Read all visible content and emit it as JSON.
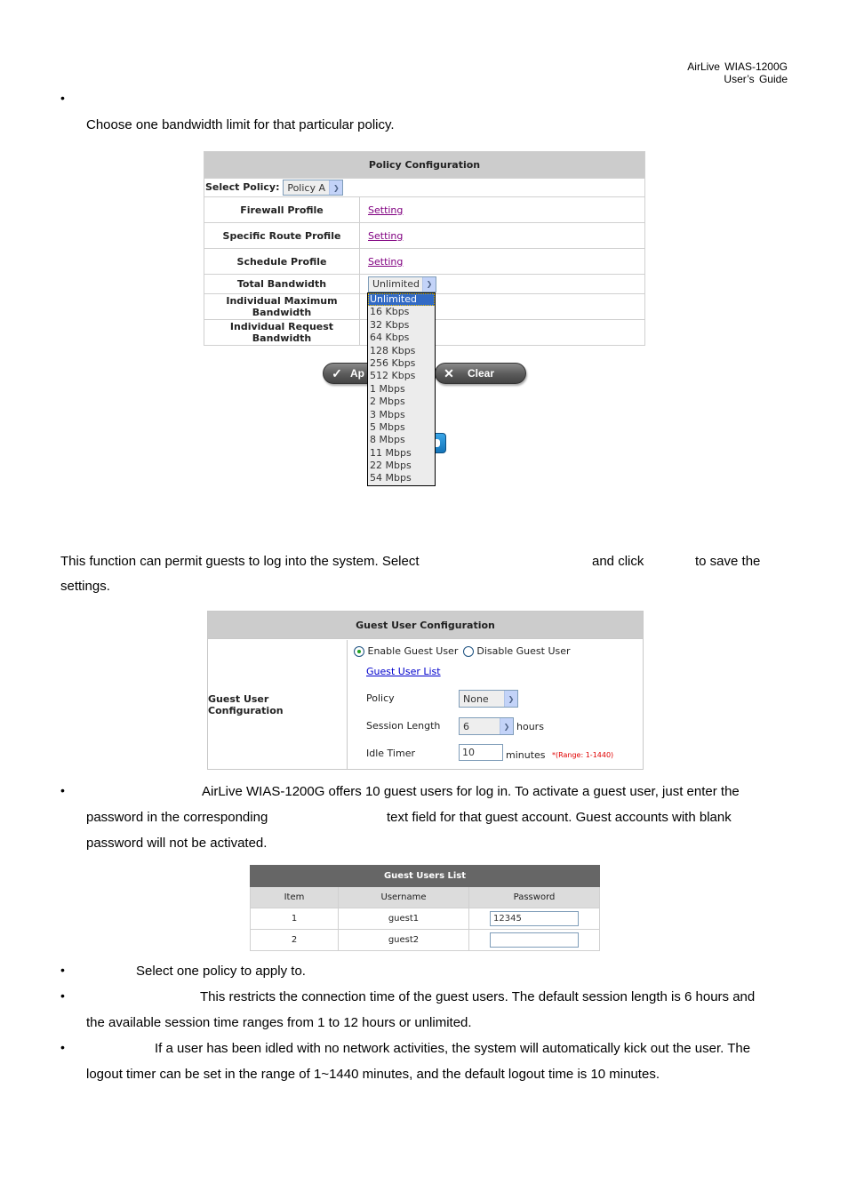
{
  "header": {
    "line1": "AirLive  WIAS-1200G",
    "line2": "User’s  Guide"
  },
  "bandwidth_section": {
    "bullet": "•",
    "description": "Choose one bandwidth limit for that particular policy."
  },
  "policy_config": {
    "title": "Policy Configuration",
    "select_policy_label": "Select Policy:",
    "select_policy_value": "Policy A",
    "rows": [
      {
        "label": "Firewall Profile",
        "link": "Setting"
      },
      {
        "label": "Specific Route Profile",
        "link": "Setting"
      },
      {
        "label": "Schedule Profile",
        "link": "Setting"
      }
    ],
    "total_bandwidth_label": "Total Bandwidth",
    "total_bandwidth_value": "Unlimited",
    "individual_max_label": "Individual Maximum Bandwidth",
    "individual_req_label": "Individual Request Bandwidth",
    "bandwidth_options": [
      "Unlimited",
      "16 Kbps",
      "32 Kbps",
      "64 Kbps",
      "128 Kbps",
      "256 Kbps",
      "512 Kbps",
      "1 Mbps",
      "2 Mbps",
      "3 Mbps",
      "5 Mbps",
      "8 Mbps",
      "11 Mbps",
      "22 Mbps",
      "54 Mbps"
    ],
    "apply_label": "Ap",
    "clear_label": "Clear"
  },
  "guest_section": {
    "intro_part1": "This function can permit guests to log into the system. Select",
    "intro_part2": "and click",
    "intro_part3": "to save the",
    "intro_part4": "settings."
  },
  "guest_config": {
    "title": "Guest User Configuration",
    "left_label": "Guest User Configuration",
    "enable_label": "Enable Guest User",
    "disable_label": "Disable Guest User",
    "enabled": true,
    "list_link": "Guest User List",
    "policy_label": "Policy",
    "policy_value": "None",
    "session_label": "Session Length",
    "session_value": "6",
    "session_unit": "hours",
    "idle_label": "Idle Timer",
    "idle_value": "10",
    "idle_unit": "minutes",
    "idle_range": "*(Range: 1-1440)"
  },
  "guest_list_text": {
    "bullet": "•",
    "line1": "AirLive WIAS-1200G offers 10 guest users for log in. To activate a guest user, just enter the",
    "line2a": "password  in  the  corresponding",
    "line2b": "text  field  for  that  guest  account.  Guest  accounts  with  blank",
    "line3": "password will not be activated."
  },
  "guest_users_list": {
    "title": "Guest Users List",
    "columns": [
      "Item",
      "Username",
      "Password"
    ],
    "rows": [
      {
        "item": "1",
        "username": "guest1",
        "password": "12345"
      },
      {
        "item": "2",
        "username": "guest2",
        "password": ""
      }
    ]
  },
  "bullets": [
    {
      "bullet": "•",
      "text": "Select one policy to apply to."
    },
    {
      "bullet": "•",
      "text": "This restricts the connection time of the guest users. The default session length is 6 hours and",
      "cont": "the available session time ranges from 1 to 12 hours or unlimited."
    },
    {
      "bullet": "•",
      "text": "If a user has been idled with no network activities, the system will automatically kick out the user. The",
      "cont": "logout timer can be set in the range of 1~1440 minutes, and the default logout time is 10 minutes."
    }
  ]
}
